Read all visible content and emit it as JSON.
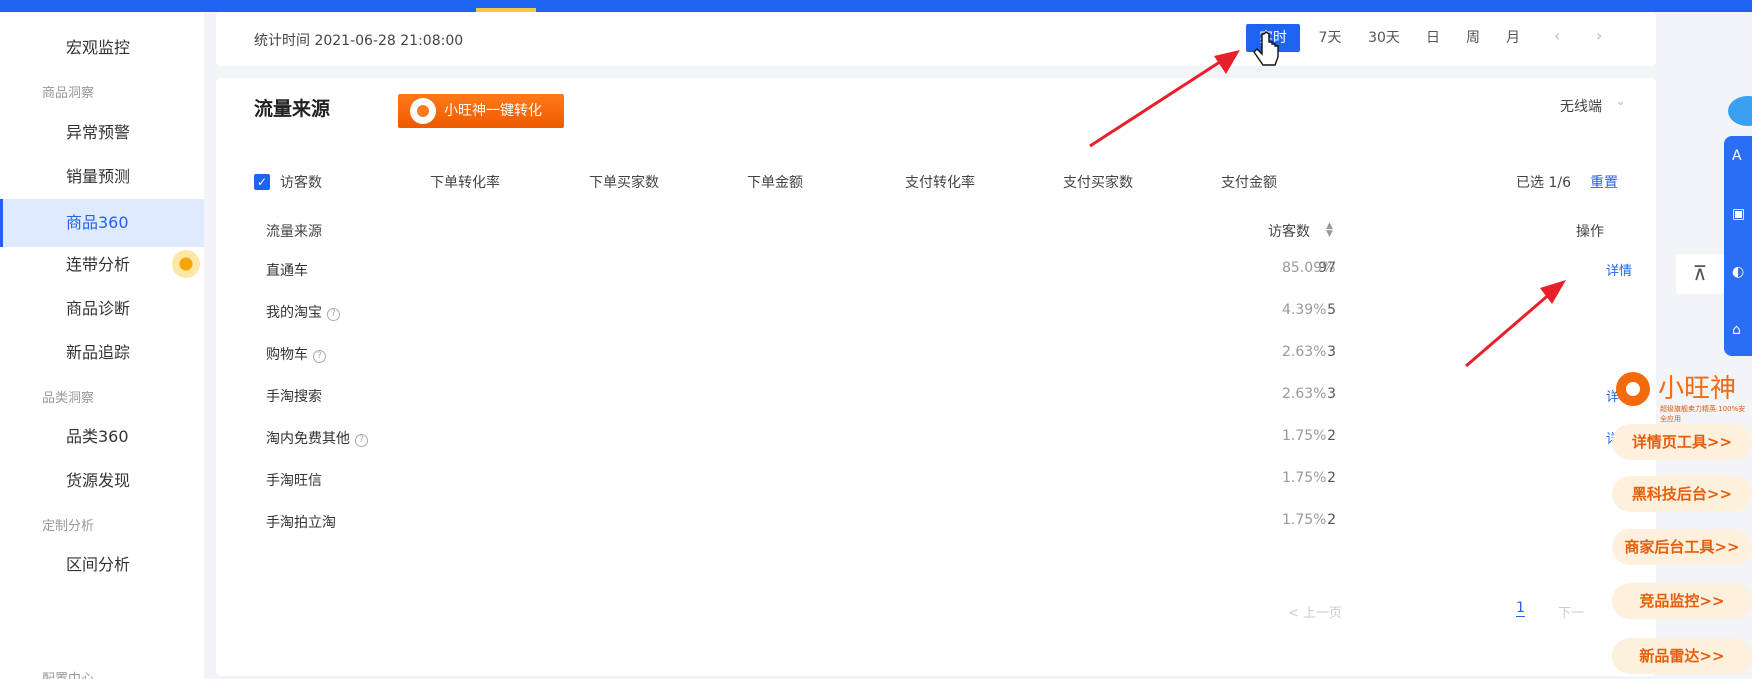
{
  "sidebar": {
    "items": [
      {
        "label": "宏观监控"
      },
      {
        "group": "商品洞察"
      },
      {
        "label": "异常预警"
      },
      {
        "label": "销量预测"
      },
      {
        "label": "商品360"
      },
      {
        "label": "连带分析"
      },
      {
        "label": "商品诊断"
      },
      {
        "label": "新品追踪"
      },
      {
        "group": "品类洞察"
      },
      {
        "label": "品类360"
      },
      {
        "label": "货源发现"
      },
      {
        "group": "定制分析"
      },
      {
        "label": "区间分析"
      },
      {
        "group": "配置中心"
      }
    ],
    "active": "商品360"
  },
  "topbar": {
    "stat_time": "统计时间 2021-06-28 21:08:00",
    "periods": [
      "实时",
      "7天",
      "30天",
      "日",
      "周",
      "月"
    ],
    "active_period": "实时",
    "prev": "‹",
    "next": "›"
  },
  "traffic": {
    "title": "流量来源",
    "promo_label": "小旺神一键转化",
    "terminal": "无线端",
    "metrics": [
      "访客数",
      "下单转化率",
      "下单买家数",
      "下单金额",
      "支付转化率",
      "支付买家数",
      "支付金额"
    ],
    "checked_metric": "访客数",
    "selected_text": "已选 1/6",
    "reset_label": "重置",
    "columns": {
      "source": "流量来源",
      "visitors": "访客数",
      "action": "操作"
    },
    "rows": [
      {
        "name": "直通车",
        "visitors": "97",
        "pct": "85.09%",
        "action": "详情",
        "help": false
      },
      {
        "name": "我的淘宝",
        "visitors": "5",
        "pct": "4.39%",
        "action": "",
        "help": true
      },
      {
        "name": "购物车",
        "visitors": "3",
        "pct": "2.63%",
        "action": "",
        "help": true
      },
      {
        "name": "手淘搜索",
        "visitors": "3",
        "pct": "2.63%",
        "action": "详",
        "help": false
      },
      {
        "name": "淘内免费其他",
        "visitors": "2",
        "pct": "1.75%",
        "action": "详",
        "help": true
      },
      {
        "name": "手淘旺信",
        "visitors": "2",
        "pct": "1.75%",
        "action": "",
        "help": false
      },
      {
        "name": "手淘拍立淘",
        "visitors": "2",
        "pct": "1.75%",
        "action": "",
        "help": false
      }
    ],
    "pager": {
      "prev": "< 上一页",
      "page": "1",
      "next": "下一"
    }
  },
  "side_ads": {
    "brand": "小旺神",
    "tagline": "超级旗舰卖力精英 100%安全应用",
    "buttons": [
      "详情页工具>>",
      "黑科技后台>>",
      "商家后台工具>>",
      "竞品监控>>",
      "新品雷达>>"
    ]
  },
  "top_button": "⊼",
  "colors": {
    "primary": "#1f64f0",
    "accent_orange": "#ee5a00",
    "arrow_red": "#e8202a"
  }
}
